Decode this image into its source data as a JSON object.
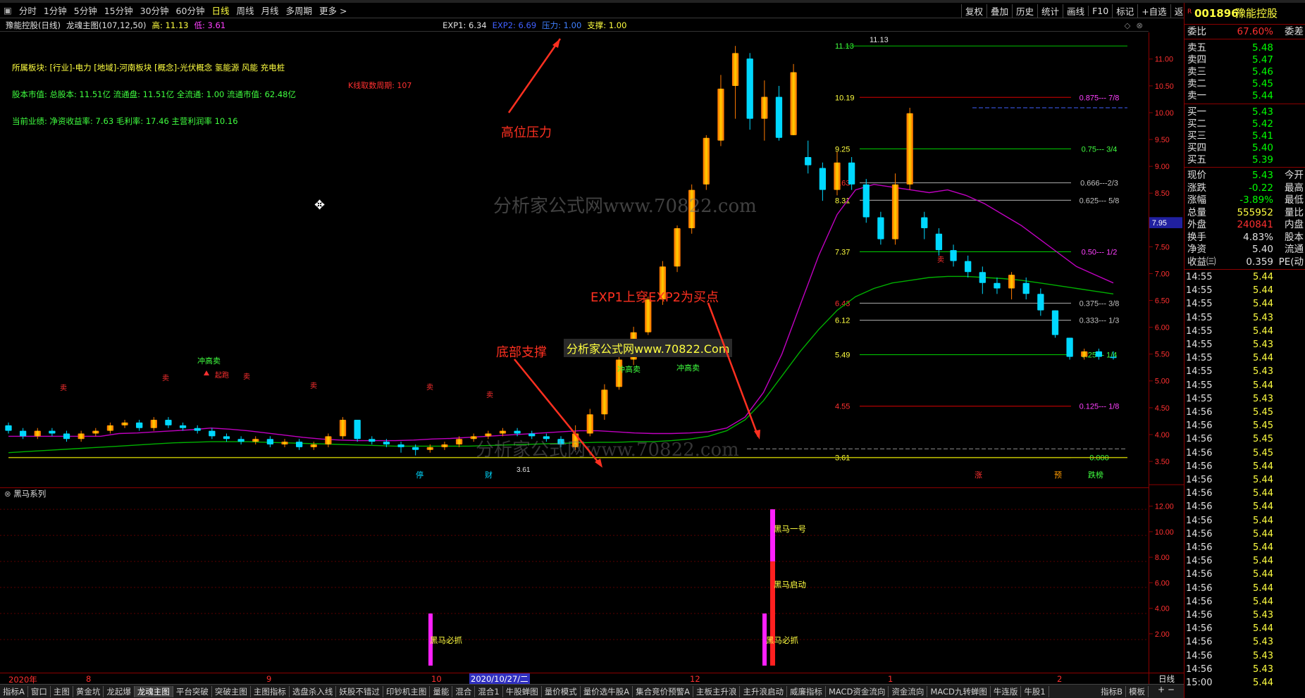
{
  "toolbar": {
    "periods": [
      "分时",
      "1分钟",
      "5分钟",
      "15分钟",
      "30分钟",
      "60分钟",
      "日线",
      "周线",
      "月线",
      "多周期",
      "更多 >"
    ],
    "active_period": "日线",
    "right_buttons": [
      "复权",
      "叠加",
      "历史",
      "统计",
      "画线",
      "F10",
      "标记",
      "+自选",
      "返回"
    ]
  },
  "chart_header": {
    "stock": "豫能控股(日线)",
    "indicator": "龙魂主图(107,12,50)",
    "high_label": "高: 11.13",
    "low_label": "低: 3.61",
    "exp1": "EXP1: 6.34",
    "exp2": "EXP2: 6.69",
    "pressure": "压力: 1.00",
    "support": "支撑: 1.00"
  },
  "info": {
    "sector": "所属板块: [行业]-电力 [地域]-河南板块 [概念]-光伏概念 氢能源 风能 充电桩",
    "equity": "股本市值: 总股本: 11.51亿 流通盘: 11.51亿 全流通: 1.00 流通市值: 62.48亿",
    "performance": "当前业绩: 净资收益率: 7.63 毛利率: 17.46 主营利润率 10.16",
    "kline_count": "K线取数周期: 107"
  },
  "annotations": {
    "high_pressure": "高位压力",
    "bottom_support": "底部支撑",
    "buy_point": "EXP1上穿EXP2为买点",
    "watermark_box": "分析家公式网www.70822.Com",
    "watermark_big": "分析家公式网www.70822.com"
  },
  "fib_levels": [
    {
      "label": "0.875--- 7/8",
      "price": 10.19,
      "color": "#b00000",
      "lcolor": "#ff40ff"
    },
    {
      "label": "0.75--- 3/4",
      "price": 9.25,
      "color": "#00c000",
      "lcolor": "#40ff40"
    },
    {
      "label": "0.666---2/3",
      "price": 8.63,
      "color": "#909090",
      "lcolor": "#c0c0c0"
    },
    {
      "label": "0.625--- 5/8",
      "price": 8.31,
      "color": "#909090",
      "lcolor": "#c0c0c0"
    },
    {
      "label": "0.50--- 1/2",
      "price": 7.37,
      "color": "#00c000",
      "lcolor": "#ff40ff"
    },
    {
      "label": "0.375--- 3/8",
      "price": 6.43,
      "color": "#909090",
      "lcolor": "#c0c0c0"
    },
    {
      "label": "0.333--- 1/3",
      "price": 6.12,
      "color": "#909090",
      "lcolor": "#c0c0c0"
    },
    {
      "label": "0.25--- 1/4",
      "price": 5.49,
      "color": "#00c000",
      "lcolor": "#40ff40"
    },
    {
      "label": "0.125--- 1/8",
      "price": 4.55,
      "color": "#b00000",
      "lcolor": "#ff40ff"
    },
    {
      "label": "0.000",
      "price": 3.61,
      "color": "#c0c000",
      "lcolor": "#40ff40"
    }
  ],
  "price_labels": [
    "11.13",
    "10.19",
    "9.25",
    "8.63",
    "8.31",
    "7.37",
    "6.43",
    "6.12",
    "5.49",
    "4.55",
    "3.61"
  ],
  "y_axis_main": [
    "11.00",
    "10.50",
    "10.00",
    "9.50",
    "9.00",
    "8.50",
    "8.00",
    "7.50",
    "7.00",
    "6.50",
    "6.00",
    "5.50",
    "5.00",
    "4.50",
    "4.00",
    "3.50"
  ],
  "y_axis_main_values": [
    11.0,
    10.5,
    10.0,
    9.5,
    9.0,
    8.5,
    8.0,
    7.5,
    7.0,
    6.5,
    6.0,
    5.5,
    5.0,
    4.5,
    4.0,
    3.5
  ],
  "crosshair_price": "7.95",
  "y_axis_sub": [
    "12.00",
    "10.00",
    "8.00",
    "6.00",
    "4.00",
    "2.00"
  ],
  "y_axis_sub_values": [
    12,
    10,
    8,
    6,
    4,
    2
  ],
  "sub_chart": {
    "title": "黑马系列",
    "signals": [
      {
        "label": "黑马必抓",
        "value": 4
      },
      {
        "label": "黑马必抓",
        "value": 4
      },
      {
        "label": "黑马启动",
        "value": 8
      },
      {
        "label": "黑马一号",
        "value": 12
      }
    ]
  },
  "markers": {
    "chonggao": "冲高卖",
    "sell": "卖",
    "breakout": "起跑",
    "ting": "停",
    "cai": "财",
    "zhang": "涨",
    "yu": "预",
    "dieting": "跌榜",
    "low_mark": "3.61",
    "high_mark": "11.13"
  },
  "date_axis": [
    "2020年",
    "8",
    "9",
    "10",
    "2020/10/27/二",
    "12",
    "1",
    "2"
  ],
  "tabs": [
    "指标A",
    "窗口",
    "主图",
    "黄金坑",
    "龙起爆",
    "龙魂主图",
    "平台突破",
    "突破主图",
    "主图指标",
    "选盘杀入线",
    "妖股不错过",
    "印钞机主图",
    "量能",
    "混合",
    "混合1",
    "牛股蝉图",
    "量价模式",
    "量价选牛股A",
    "集合竞价预警A",
    "主板主升浪",
    "主升浪启动",
    "威廉指标",
    "MACD资金流向",
    "资金流向",
    "MACD九转蝉图",
    "牛连版",
    "牛股1"
  ],
  "tabs_right": [
    "指标B",
    "模板"
  ],
  "sidebar": {
    "code": "001896",
    "name": "豫能控股",
    "weibi_label": "委比",
    "weibi": "67.60%",
    "weicha_label": "委差",
    "asks": [
      {
        "label": "卖五",
        "price": "5.48"
      },
      {
        "label": "卖四",
        "price": "5.47"
      },
      {
        "label": "卖三",
        "price": "5.46"
      },
      {
        "label": "卖二",
        "price": "5.45"
      },
      {
        "label": "卖一",
        "price": "5.44"
      }
    ],
    "bids": [
      {
        "label": "买一",
        "price": "5.43"
      },
      {
        "label": "买二",
        "price": "5.42"
      },
      {
        "label": "买三",
        "price": "5.41"
      },
      {
        "label": "买四",
        "price": "5.40"
      },
      {
        "label": "买五",
        "price": "5.39"
      }
    ],
    "stats": [
      {
        "l": "现价",
        "v": "5.43",
        "c": "#00ff00",
        "r": "今开"
      },
      {
        "l": "涨跌",
        "v": "-0.22",
        "c": "#00ff00",
        "r": "最高"
      },
      {
        "l": "涨幅",
        "v": "-3.89%",
        "c": "#00ff00",
        "r": "最低"
      },
      {
        "l": "总量",
        "v": "555952",
        "c": "#ffff40",
        "r": "量比"
      },
      {
        "l": "外盘",
        "v": "240841",
        "c": "#ff3030",
        "r": "内盘"
      },
      {
        "l": "换手",
        "v": "4.83%",
        "c": "#e0e0e0",
        "r": "股本"
      },
      {
        "l": "净资",
        "v": "5.40",
        "c": "#e0e0e0",
        "r": "流通"
      },
      {
        "l": "收益㈢",
        "v": "0.359",
        "c": "#e0e0e0",
        "r": "PE(动"
      }
    ],
    "ticks": [
      [
        "14:55",
        "5.44"
      ],
      [
        "14:55",
        "5.44"
      ],
      [
        "14:55",
        "5.44"
      ],
      [
        "14:55",
        "5.43"
      ],
      [
        "14:55",
        "5.44"
      ],
      [
        "14:55",
        "5.43"
      ],
      [
        "14:55",
        "5.44"
      ],
      [
        "14:55",
        "5.43"
      ],
      [
        "14:55",
        "5.44"
      ],
      [
        "14:55",
        "5.43"
      ],
      [
        "14:56",
        "5.45"
      ],
      [
        "14:56",
        "5.45"
      ],
      [
        "14:56",
        "5.45"
      ],
      [
        "14:56",
        "5.45"
      ],
      [
        "14:56",
        "5.44"
      ],
      [
        "14:56",
        "5.44"
      ],
      [
        "14:56",
        "5.44"
      ],
      [
        "14:56",
        "5.44"
      ],
      [
        "14:56",
        "5.44"
      ],
      [
        "14:56",
        "5.44"
      ],
      [
        "14:56",
        "5.44"
      ],
      [
        "14:56",
        "5.44"
      ],
      [
        "14:56",
        "5.44"
      ],
      [
        "14:56",
        "5.44"
      ],
      [
        "14:56",
        "5.44"
      ],
      [
        "14:56",
        "5.43"
      ],
      [
        "14:56",
        "5.44"
      ],
      [
        "14:56",
        "5.43"
      ],
      [
        "14:56",
        "5.43"
      ],
      [
        "14:56",
        "5.43"
      ],
      [
        "15:00",
        "5.44"
      ]
    ]
  },
  "colors": {
    "up": "#ff3030",
    "down": "#00d8ff",
    "exp1": "#c000c0",
    "exp2": "#00b000",
    "annotation": "#ff3020",
    "accent": "#ffff40"
  },
  "chart_data": {
    "type": "candlestick",
    "ylim": [
      3.4,
      11.3
    ],
    "exp1": [
      4.0,
      4.0,
      4.0,
      4.0,
      4.0,
      4.0,
      4.05,
      4.06,
      4.08,
      4.1,
      4.12,
      4.15,
      4.13,
      4.1,
      4.06,
      4.02,
      3.98,
      3.95,
      3.93,
      3.92,
      3.92,
      3.92,
      3.93,
      3.95,
      3.96,
      3.98,
      4.0,
      4.02,
      4.04,
      4.06,
      4.08,
      4.1,
      4.1,
      4.08,
      4.06,
      4.05,
      4.05,
      4.06,
      4.08,
      4.15,
      4.35,
      4.8,
      5.5,
      6.4,
      7.3,
      8.05,
      8.5,
      8.6,
      8.55,
      8.5,
      8.45,
      8.5,
      8.4,
      8.25,
      8.05,
      7.85,
      7.6,
      7.35,
      7.1,
      6.95,
      6.8
    ],
    "exp2": [
      3.7,
      3.72,
      3.74,
      3.76,
      3.78,
      3.8,
      3.82,
      3.84,
      3.86,
      3.88,
      3.89,
      3.9,
      3.9,
      3.9,
      3.89,
      3.88,
      3.87,
      3.86,
      3.85,
      3.84,
      3.83,
      3.82,
      3.82,
      3.82,
      3.82,
      3.82,
      3.83,
      3.84,
      3.85,
      3.86,
      3.87,
      3.88,
      3.89,
      3.89,
      3.9,
      3.9,
      3.92,
      3.95,
      4.0,
      4.1,
      4.3,
      4.65,
      5.1,
      5.55,
      5.95,
      6.3,
      6.55,
      6.7,
      6.8,
      6.85,
      6.9,
      6.92,
      6.92,
      6.9,
      6.88,
      6.85,
      6.8,
      6.75,
      6.7,
      6.65,
      6.6
    ],
    "candles": [
      [
        4.2,
        4.1,
        4.25,
        4.05
      ],
      [
        4.1,
        4.0,
        4.15,
        3.95
      ],
      [
        4.0,
        4.1,
        4.15,
        3.95
      ],
      [
        4.1,
        4.05,
        4.15,
        4.0
      ],
      [
        4.05,
        3.95,
        4.1,
        3.9
      ],
      [
        3.95,
        4.05,
        4.1,
        3.9
      ],
      [
        4.05,
        4.1,
        4.15,
        4.0
      ],
      [
        4.1,
        4.2,
        4.25,
        4.05
      ],
      [
        4.2,
        4.25,
        4.3,
        4.15
      ],
      [
        4.25,
        4.15,
        4.3,
        4.1
      ],
      [
        4.15,
        4.3,
        4.35,
        4.1
      ],
      [
        4.3,
        4.2,
        4.35,
        4.15
      ],
      [
        4.2,
        4.15,
        4.25,
        4.1
      ],
      [
        4.15,
        4.1,
        4.2,
        4.05
      ],
      [
        4.1,
        4.0,
        4.15,
        3.95
      ],
      [
        4.0,
        3.95,
        4.05,
        3.9
      ],
      [
        3.95,
        3.9,
        4.0,
        3.85
      ],
      [
        3.9,
        3.95,
        4.0,
        3.85
      ],
      [
        3.95,
        3.85,
        4.0,
        3.8
      ],
      [
        3.85,
        3.9,
        3.95,
        3.8
      ],
      [
        3.9,
        3.8,
        3.95,
        3.75
      ],
      [
        3.8,
        3.85,
        3.9,
        3.75
      ],
      [
        3.85,
        4.0,
        4.05,
        3.8
      ],
      [
        4.0,
        4.3,
        4.35,
        3.95
      ],
      [
        4.3,
        3.95,
        4.3,
        3.9
      ],
      [
        3.95,
        3.9,
        4.0,
        3.85
      ],
      [
        3.9,
        3.85,
        3.95,
        3.8
      ],
      [
        3.85,
        3.8,
        3.9,
        3.7
      ],
      [
        3.8,
        3.75,
        3.85,
        3.65
      ],
      [
        3.75,
        3.8,
        3.85,
        3.7
      ],
      [
        3.8,
        3.85,
        3.9,
        3.75
      ],
      [
        3.85,
        3.95,
        4.0,
        3.8
      ],
      [
        3.95,
        4.0,
        4.05,
        3.9
      ],
      [
        4.0,
        4.05,
        4.1,
        3.95
      ],
      [
        4.05,
        4.1,
        4.15,
        4.0
      ],
      [
        4.1,
        4.05,
        4.15,
        4.0
      ],
      [
        4.05,
        4.0,
        4.1,
        3.95
      ],
      [
        4.0,
        3.95,
        4.05,
        3.9
      ],
      [
        3.95,
        3.85,
        4.0,
        3.8
      ],
      [
        3.8,
        4.05,
        4.2,
        3.75
      ],
      [
        4.05,
        4.4,
        4.5,
        4.0
      ],
      [
        4.4,
        4.85,
        4.95,
        4.3
      ],
      [
        4.9,
        5.4,
        5.5,
        4.85
      ],
      [
        5.4,
        5.9,
        6.0,
        5.3
      ],
      [
        5.9,
        6.5,
        6.55,
        5.85
      ],
      [
        6.5,
        7.1,
        7.2,
        6.4
      ],
      [
        7.1,
        7.8,
        7.85,
        7.0
      ],
      [
        7.8,
        8.5,
        8.6,
        7.7
      ],
      [
        8.6,
        9.45,
        9.5,
        8.5
      ],
      [
        9.4,
        10.35,
        10.6,
        9.3
      ],
      [
        10.4,
        11.0,
        11.13,
        9.8
      ],
      [
        10.9,
        9.8,
        11.0,
        9.6
      ],
      [
        9.8,
        10.2,
        10.5,
        9.4
      ],
      [
        10.2,
        9.45,
        10.4,
        9.4
      ],
      [
        9.5,
        10.65,
        10.8,
        9.5
      ],
      [
        9.1,
        8.95,
        9.4,
        8.8
      ],
      [
        8.9,
        8.5,
        9.0,
        8.3
      ],
      [
        8.5,
        9.0,
        9.2,
        8.4
      ],
      [
        9.0,
        8.6,
        9.1,
        8.5
      ],
      [
        8.6,
        8.0,
        8.7,
        7.9
      ],
      [
        8.0,
        7.6,
        8.1,
        7.5
      ],
      [
        7.6,
        8.6,
        8.8,
        7.5
      ],
      [
        8.6,
        9.9,
        10.0,
        8.5
      ],
      [
        8.0,
        7.8,
        8.1,
        7.6
      ],
      [
        7.7,
        7.4,
        7.8,
        7.3
      ],
      [
        7.4,
        7.2,
        7.5,
        7.1
      ],
      [
        7.2,
        7.0,
        7.3,
        6.9
      ],
      [
        7.0,
        6.8,
        7.1,
        6.6
      ],
      [
        6.8,
        6.7,
        6.9,
        6.6
      ],
      [
        6.7,
        6.95,
        7.0,
        6.5
      ],
      [
        6.8,
        6.6,
        6.9,
        6.5
      ],
      [
        6.6,
        6.3,
        6.7,
        6.2
      ],
      [
        6.3,
        5.85,
        6.3,
        5.8
      ],
      [
        5.8,
        5.45,
        5.8,
        5.4
      ],
      [
        5.45,
        5.55,
        5.6,
        5.4
      ],
      [
        5.55,
        5.45,
        5.6,
        5.4
      ],
      [
        5.45,
        5.43,
        5.55,
        5.4
      ]
    ]
  }
}
